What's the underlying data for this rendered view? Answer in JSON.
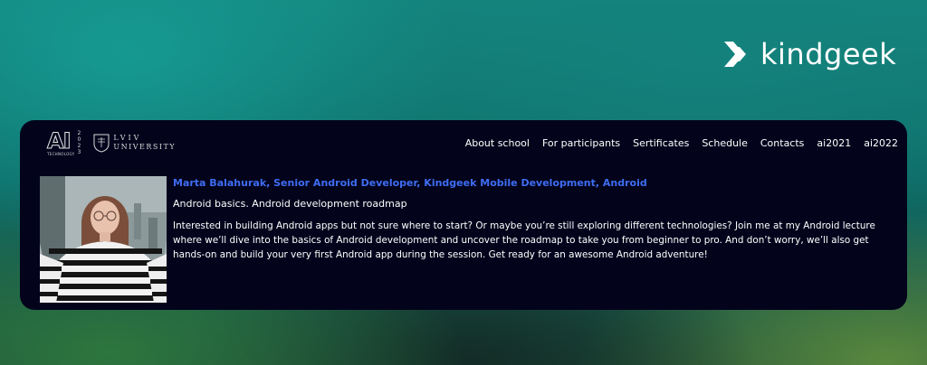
{
  "brand": {
    "name": "kindgeek",
    "mark_icon": "kindgeek-chevrons-icon"
  },
  "header": {
    "ai_logo_text": "AI",
    "ai_logo_year": [
      "2",
      "0",
      "2",
      "3"
    ],
    "ai_logo_caption": "TECHNOLOGY",
    "university_line1": "LVIV",
    "university_line2": "UNIVERSITY",
    "nav": [
      {
        "label": "About school"
      },
      {
        "label": "For participants"
      },
      {
        "label": "Sertificates"
      },
      {
        "label": "Schedule"
      },
      {
        "label": "Contacts"
      },
      {
        "label": "ai2021"
      },
      {
        "label": "ai2022"
      }
    ]
  },
  "talk": {
    "speaker": "Marta Balahurak, Senior Android Developer, Kindgeek Mobile Development, Android",
    "title": "Android basics. Android development roadmap",
    "description": "Interested in building Android apps but not sure where to start? Or maybe you’re still exploring different technologies?  Join me at my Android lecture where we’ll dive into the basics of Android development and uncover the roadmap to take you from beginner to pro. And don’t worry, we’ll also get hands-on and build your very first Android app during the session. Get ready for an awesome Android adventure!"
  },
  "colors": {
    "card_background": "#03041c",
    "speaker_text": "#3f6cf2",
    "text": "#ffffff"
  }
}
